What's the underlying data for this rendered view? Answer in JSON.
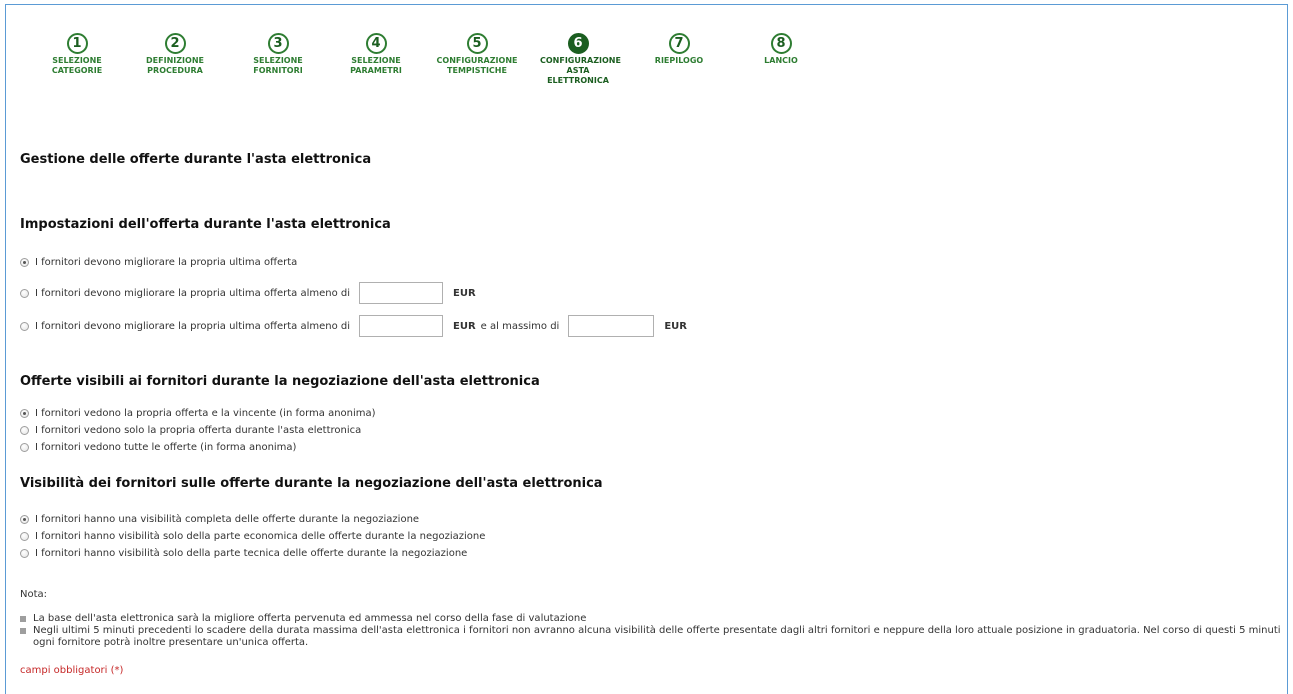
{
  "steps": [
    {
      "num": "1",
      "label": "SELEZIONE CATEGORIE"
    },
    {
      "num": "2",
      "label": "DEFINIZIONE PROCEDURA"
    },
    {
      "num": "3",
      "label": "SELEZIONE FORNITORI"
    },
    {
      "num": "4",
      "label": "SELEZIONE PARAMETRI"
    },
    {
      "num": "5",
      "label": "CONFIGURAZIONE TEMPISTICHE"
    },
    {
      "num": "6",
      "label": "CONFIGURAZIONE ASTA ELETTRONICA"
    },
    {
      "num": "7",
      "label": "RIEPILOGO"
    },
    {
      "num": "8",
      "label": "LANCIO"
    }
  ],
  "active_step": "6",
  "page_title": "Gestione delle offerte durante l'asta elettronica",
  "offer_settings": {
    "title": "Impostazioni dell'offerta durante l'asta elettronica",
    "option1": "I fornitori devono migliorare la propria ultima offerta",
    "option2": "I fornitori devono migliorare la propria ultima offerta almeno di",
    "option2_unit": "EUR",
    "option3": "I fornitori devono migliorare la propria ultima offerta almeno di",
    "option3_unit": "EUR",
    "option3_middle": "e al massimo di",
    "option3_unit2": "EUR",
    "selected": 1
  },
  "visible_offers": {
    "title": "Offerte visibili ai fornitori durante la negoziazione dell'asta elettronica",
    "options": [
      "I fornitori vedono la propria offerta e la vincente (in forma anonima)",
      "I fornitori vedono solo la propria offerta durante l'asta elettronica",
      "I fornitori vedono tutte le offerte (in forma anonima)"
    ],
    "selected": 1
  },
  "visibility": {
    "title": "Visibilità dei fornitori sulle offerte durante la negoziazione dell'asta elettronica",
    "options": [
      "I fornitori hanno una visibilità completa delle offerte durante la negoziazione",
      "I fornitori hanno visibilità solo della parte economica delle offerte durante la negoziazione",
      "I fornitori hanno visibilità solo della parte tecnica delle offerte durante la negoziazione"
    ],
    "selected": 1
  },
  "nota_label": "Nota:",
  "notes": [
    "La base dell'asta elettronica sarà la migliore offerta pervenuta ed ammessa nel corso della fase di valutazione",
    "Negli ultimi 5 minuti precedenti lo scadere della durata massima dell'asta elettronica i fornitori non avranno alcuna visibilità delle offerte presentate dagli altri fornitori e neppure della loro attuale posizione in graduatoria. Nel corso di questi 5 minuti ogni fornitore potrà inoltre presentare un'unica offerta."
  ],
  "required_fields": "campi obbligatori (*)"
}
